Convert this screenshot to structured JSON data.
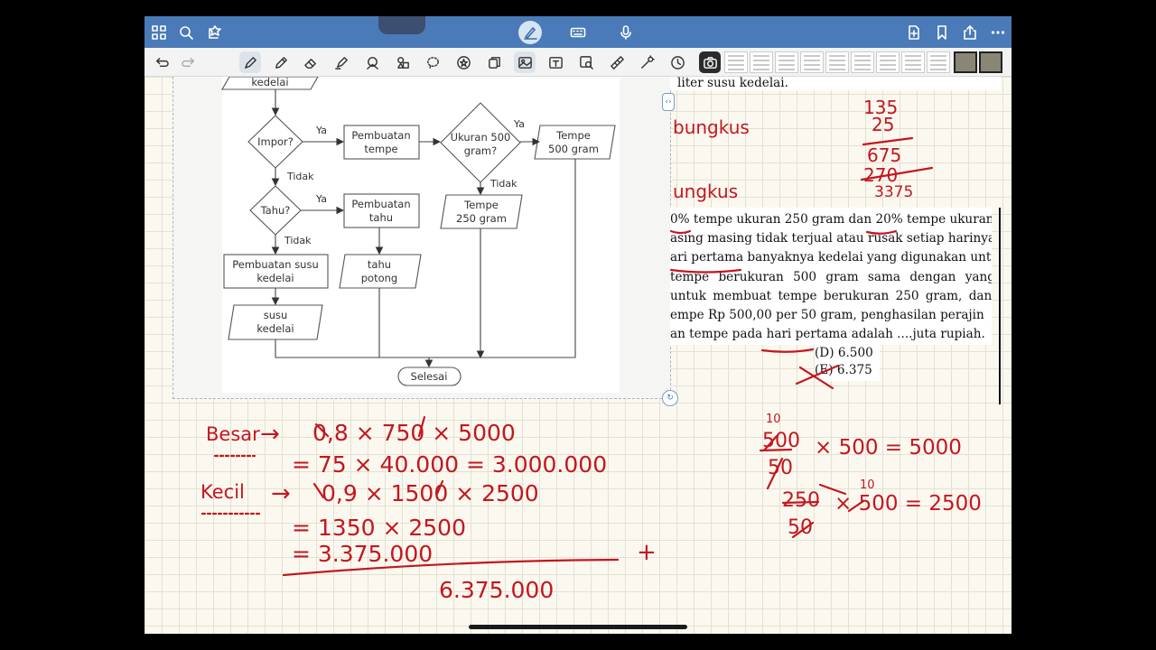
{
  "flowchart": {
    "nodes": {
      "kedelai_top": "kedelai",
      "impor": "Impor?",
      "pembuatan_tempe": [
        "Pembuatan",
        "tempe"
      ],
      "ukuran": [
        "Ukuran 500",
        "gram?"
      ],
      "tempe_500": [
        "Tempe",
        "500 gram"
      ],
      "tahu_q": "Tahu?",
      "pembuatan_tahu": [
        "Pembuatan",
        "tahu"
      ],
      "tempe_250": [
        "Tempe",
        "250 gram"
      ],
      "pembuatan_susu": [
        "Pembuatan susu",
        "kedelai"
      ],
      "tahu_potong": [
        "tahu",
        "potong"
      ],
      "susu_kedelai": [
        "susu",
        "kedelai"
      ],
      "selesai": "Selesai"
    },
    "labels": {
      "ya": "Ya",
      "tidak": "Tidak"
    }
  },
  "problem": {
    "top_line": "liter susu kedelai.",
    "para": [
      "0% tempe ukuran 250 gram dan 20% tempe ukuran",
      "asing masing tidak terjual atau rusak setiap harinya.",
      "ari pertama banyaknya kedelai yang digunakan untuk",
      "tempe berukuran 500 gram sama dengan yang",
      "untuk membuat tempe berukuran 250 gram, dan",
      "empe Rp 500,00 per 50 gram, penghasilan perajin",
      "an tempe pada hari pertama adalah ....juta rupiah."
    ],
    "options": [
      "(D) 6.500",
      "(E) 6.375"
    ]
  },
  "ink": {
    "top_right": [
      "bungkus",
      "ungkus",
      "135",
      "25",
      "675",
      "270",
      "3375"
    ],
    "besar": "Besar",
    "kecil": "Kecil",
    "lines": {
      "l1": "0,8 × 750 × 5000",
      "l2": "= 75 × 40.000 = 3.000.000",
      "l3": "0,9 × 1500 × 2500",
      "l4": "= 1350 × 2500",
      "l5": "= 3.375.000",
      "total": "6.375.000",
      "plus": "+",
      "arrow": "→"
    },
    "right": {
      "r1_num": "500",
      "r1_den": "50",
      "r1_rest": "× 500 = 5000",
      "r1_sup": "10",
      "r2_num": "250",
      "r2_den": "50",
      "r2_rest": "× 500 = 2500",
      "r2_sup": "10"
    }
  },
  "colors": {
    "ink": "#c41620",
    "toolbar_blue": "#4a7ab8"
  }
}
